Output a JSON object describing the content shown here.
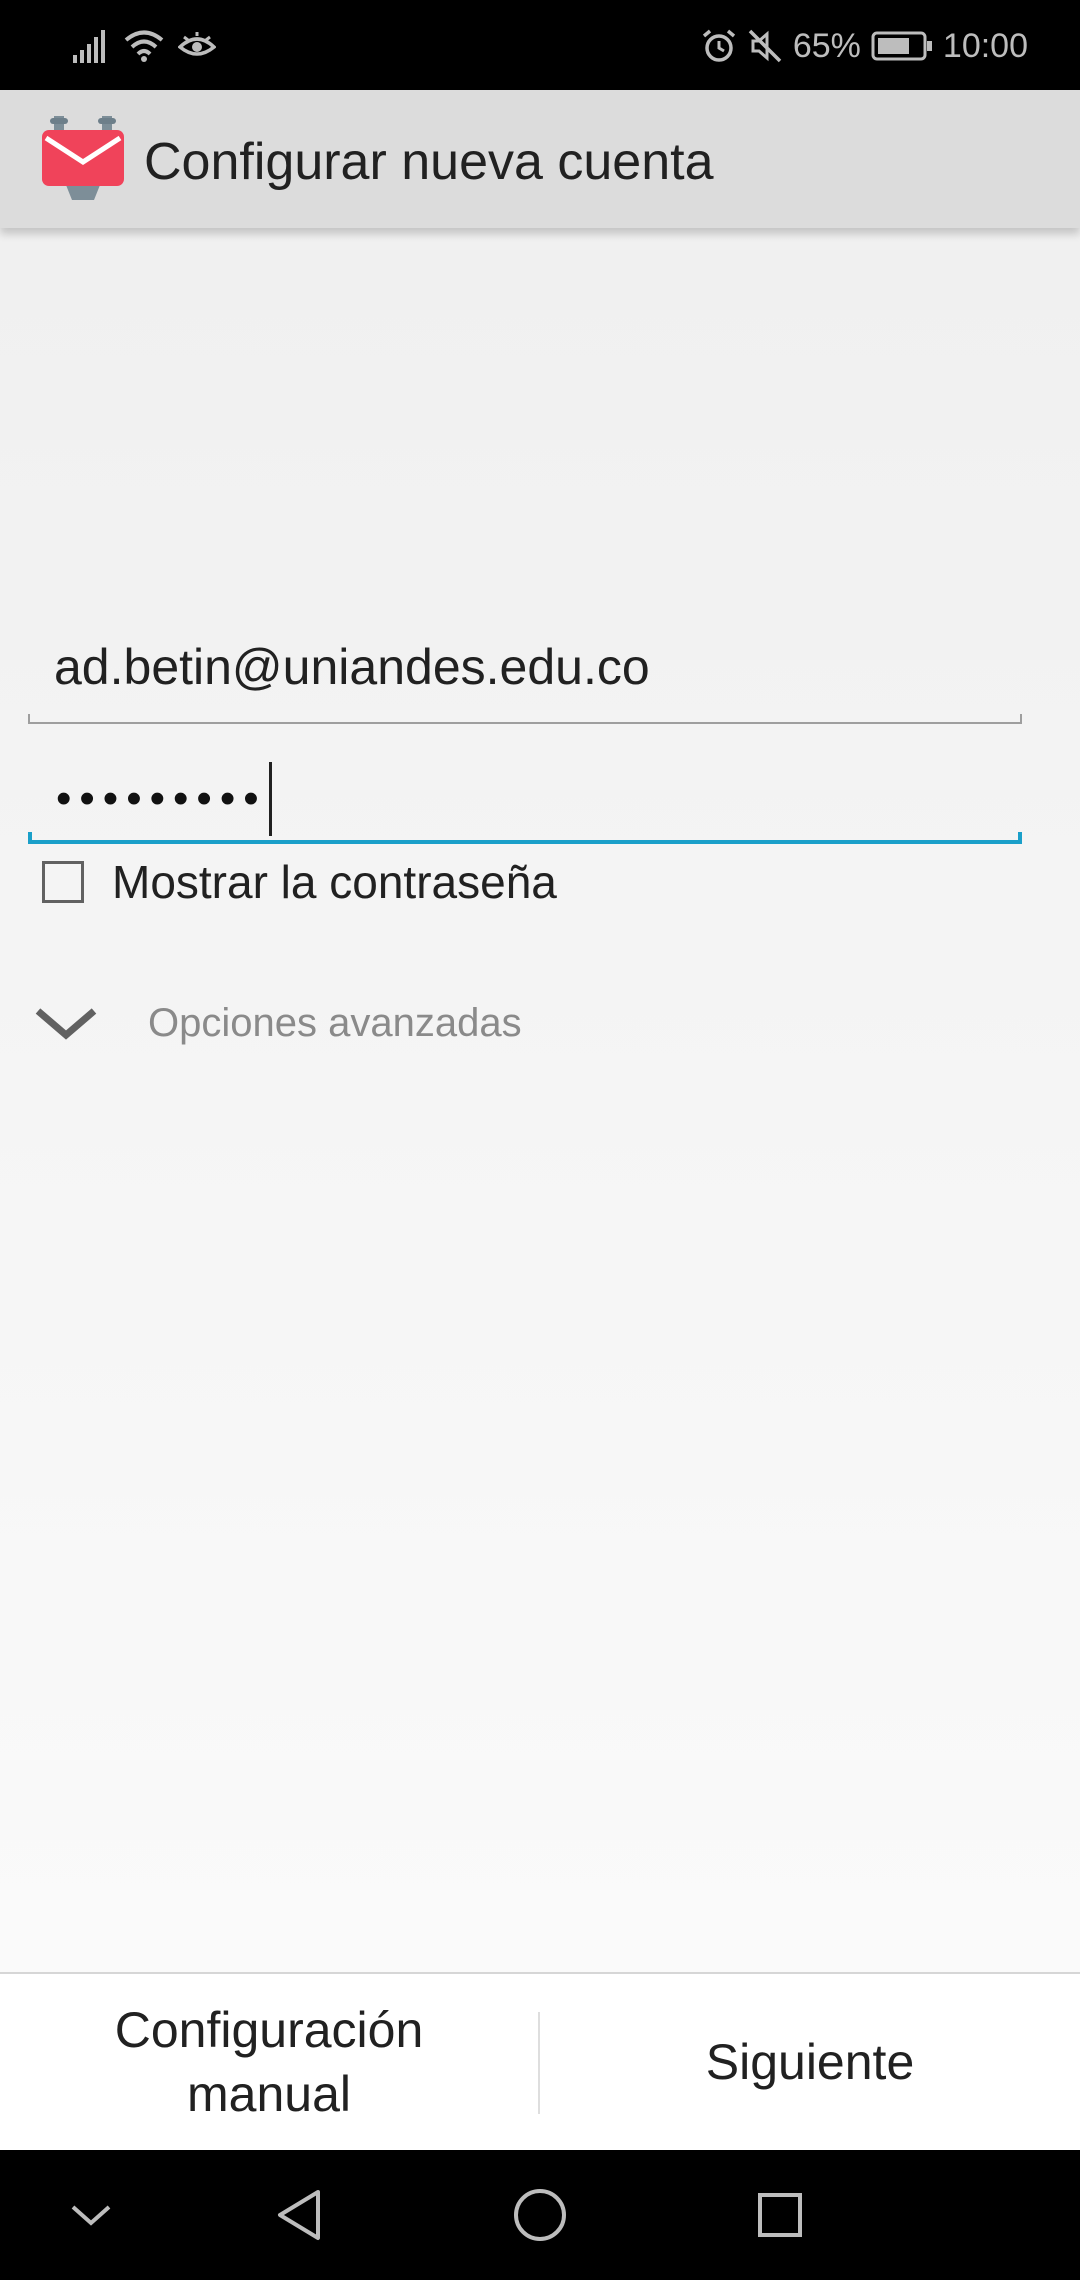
{
  "status_bar": {
    "battery_percent": "65%",
    "time": "10:00",
    "icons": [
      "signal-icon",
      "wifi-icon",
      "eye-icon",
      "alarm-icon",
      "mute-icon",
      "battery-icon"
    ]
  },
  "app_bar": {
    "title": "Configurar nueva cuenta",
    "logo_icon": "mail-app-logo-icon"
  },
  "form": {
    "email_value": "ad.betin@uniandes.edu.co",
    "password_masked": "•••••••••",
    "show_password_label": "Mostrar la contraseña",
    "show_password_checked": false,
    "advanced_options_label": "Opciones avanzadas"
  },
  "buttons": {
    "manual_label": "Configuración manual",
    "next_label": "Siguiente"
  },
  "navigation": {
    "icons": [
      "collapse-icon",
      "back-icon",
      "home-icon",
      "recents-icon"
    ]
  },
  "colors": {
    "accent": "#1a9fc9",
    "logo": "#f0435a",
    "app_bar": "#dcdcdc"
  }
}
